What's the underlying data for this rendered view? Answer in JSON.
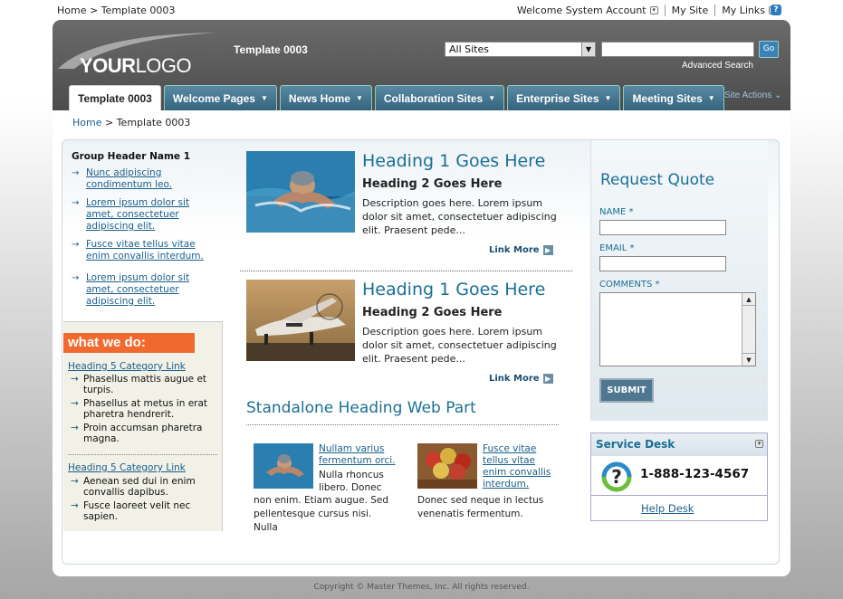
{
  "topbar": {
    "breadcrumb": [
      "Home",
      "Template 0003"
    ],
    "welcome": "Welcome System Account",
    "my_site": "My Site",
    "my_links": "My Links"
  },
  "header": {
    "logo_bold": "YOUR",
    "logo_light": "LOGO",
    "site_title": "Template 0003",
    "scope_selected": "All Sites",
    "search_go": "Go",
    "advanced_search": "Advanced Search",
    "site_actions": "Site Actions"
  },
  "nav": {
    "tabs": [
      {
        "label": "Template 0003",
        "active": true
      },
      {
        "label": "Welcome Pages"
      },
      {
        "label": "News Home"
      },
      {
        "label": "Collaboration Sites"
      },
      {
        "label": "Enterprise Sites"
      },
      {
        "label": "Meeting Sites"
      }
    ]
  },
  "content_breadcrumb": [
    "Home",
    "Template 0003"
  ],
  "left": {
    "group_header": "Group Header Name 1",
    "group_links": [
      "Nunc adipiscing condimentum leo.",
      "Lorem ipsum dolor sit amet, consectetuer adipiscing elit.",
      "Fusce vitae tellus vitae enim convallis interdum.",
      "Lorem ipsum dolor sit amet, consectetuer adipiscing elit."
    ],
    "what_we_do": "what we do:",
    "cat1_link": "Heading 5 Category Link",
    "cat1_items": [
      "Phasellus mattis augue et turpis.",
      "Phasellus at metus in erat pharetra hendrerit.",
      "Proin accumsan pharetra magna."
    ],
    "cat2_link": "Heading 5 Category Link",
    "cat2_items": [
      "Aenean sed dui in enim convallis dapibus.",
      "Fusce laoreet velit nec sapien."
    ]
  },
  "articles": [
    {
      "h1": "Heading 1 Goes Here",
      "h2": "Heading 2 Goes Here",
      "desc": "Description goes here. Lorem ipsum dolor sit amet, consectetuer adipiscing elit. Praesent pede...",
      "more": "Link More"
    },
    {
      "h1": "Heading 1 Goes Here",
      "h2": "Heading 2 Goes Here",
      "desc": "Description goes here. Lorem ipsum dolor sit amet, consectetuer adipiscing elit. Praesent pede...",
      "more": "Link More"
    }
  ],
  "standalone": {
    "heading": "Standalone Heading Web Part",
    "items": [
      {
        "link": "Nullam varius fermentum orci.",
        "side": "Nulla rhoncus libero. Donec",
        "text": "non enim. Etiam augue. Sed pellentesque cursus nisi. Nulla"
      },
      {
        "link": "Fusce vitae tellus vitae enim convallis interdum.",
        "text": "Donec sed neque in lectus venenatis fermentum."
      }
    ]
  },
  "request_quote": {
    "title": "Request Quote",
    "name_label": "NAME *",
    "email_label": "EMAIL *",
    "comments_label": "COMMENTS *",
    "submit": "SUBMIT"
  },
  "service_desk": {
    "title": "Service Desk",
    "phone": "1-888-123-4567",
    "help_link": "Help Desk"
  },
  "footer": {
    "copyright": "Copyright © Master Themes, Inc. All rights reserved."
  }
}
